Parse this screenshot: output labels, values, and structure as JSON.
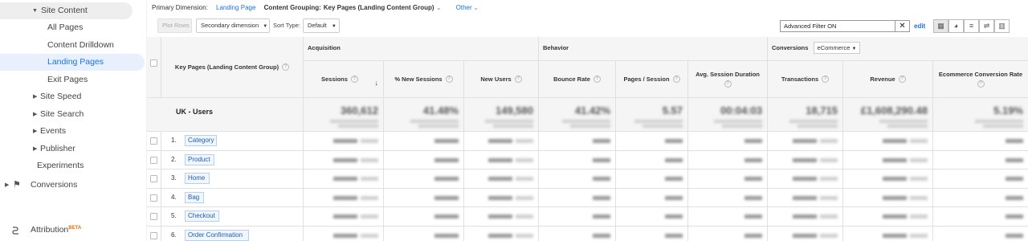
{
  "sidebar": {
    "items": [
      {
        "label": "Site Content",
        "state": "expanded-group"
      },
      {
        "label": "All Pages",
        "state": "child"
      },
      {
        "label": "Content Drilldown",
        "state": "child"
      },
      {
        "label": "Landing Pages",
        "state": "selected"
      },
      {
        "label": "Exit Pages",
        "state": "child"
      },
      {
        "label": "Site Speed",
        "state": "collapsed"
      },
      {
        "label": "Site Search",
        "state": "collapsed"
      },
      {
        "label": "Events",
        "state": "collapsed"
      },
      {
        "label": "Publisher",
        "state": "collapsed"
      },
      {
        "label": "Experiments",
        "state": "plain"
      },
      {
        "label": "Conversions",
        "state": "top-level"
      },
      {
        "label": "Attribution",
        "state": "top-level"
      }
    ],
    "beta_badge": "BETA"
  },
  "dimension_bar": {
    "primary_label": "Primary Dimension:",
    "primary_value": "Landing Page",
    "grouping_label": "Content Grouping:",
    "grouping_value": "Key Pages (Landing Content Group)",
    "other": "Other"
  },
  "toolbar": {
    "plot_rows": "Plot Rows",
    "secondary_dimension": "Secondary dimension",
    "sort_type_label": "Sort Type:",
    "sort_type_value": "Default",
    "filter_value": "Advanced Filter ON",
    "edit": "edit"
  },
  "table": {
    "dimension_header": "Key Pages (Landing Content Group)",
    "groups": {
      "acquisition": "Acquisition",
      "behavior": "Behavior",
      "conversions": "Conversions",
      "conversions_select": "eCommerce"
    },
    "columns": [
      "Sessions",
      "% New Sessions",
      "New Users",
      "Bounce Rate",
      "Pages / Session",
      "Avg. Session Duration",
      "Transactions",
      "Revenue",
      "Ecommerce Conversion Rate"
    ],
    "segment_label": "UK - Users",
    "totals": [
      "360,612",
      "41.48%",
      "149,580",
      "41.42%",
      "5.57",
      "00:04:03",
      "18,715",
      "£1,608,290.48",
      "5.19%"
    ],
    "rows": [
      {
        "num": "1.",
        "label": "Category"
      },
      {
        "num": "2.",
        "label": "Product"
      },
      {
        "num": "3.",
        "label": "Home"
      },
      {
        "num": "4.",
        "label": "Bag"
      },
      {
        "num": "5.",
        "label": "Checkout"
      },
      {
        "num": "6.",
        "label": "Order Confirmation"
      }
    ]
  },
  "colors": {
    "accent": "#1a73e8",
    "selected_bg": "#e8f0fe",
    "beta": "#e8710a"
  }
}
